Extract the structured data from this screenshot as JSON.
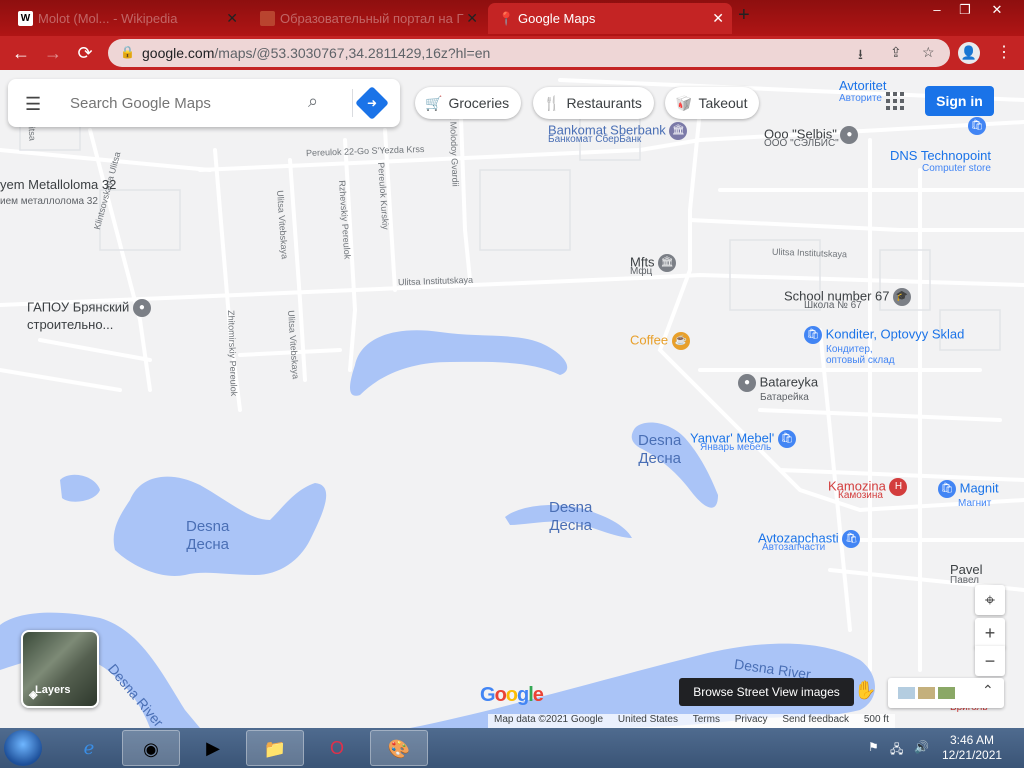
{
  "browser": {
    "tabs": [
      {
        "title": "Molot (Mol... - Wikipedia",
        "favicon": "W",
        "state": "inactive"
      },
      {
        "title": "Образовательный портал на Г",
        "favicon": "logo",
        "state": "inactive"
      },
      {
        "title": "Google Maps",
        "favicon": "maps-pin",
        "state": "active"
      }
    ],
    "new_tab": "+",
    "window_controls": {
      "minimize": "–",
      "restore": "❐",
      "close": "✕"
    },
    "nav": {
      "back": "←",
      "forward": "→",
      "reload": "⟳"
    },
    "url_host": "google.com",
    "url_path": "/maps/@53.3030767,34.2811429,16z?hl=en"
  },
  "maps": {
    "search_placeholder": "Search Google Maps",
    "chips": [
      {
        "label": "Groceries",
        "icon": "🛒"
      },
      {
        "label": "Restaurants",
        "icon": "🍴"
      },
      {
        "label": "Takeout",
        "icon": "🥡"
      }
    ],
    "signin": "Sign in",
    "layers_label": "Layers",
    "tooltip": "Browse Street View images",
    "logo": "Google",
    "footer": {
      "map_data": "Map data ©2021 Google",
      "country": "United States",
      "terms": "Terms",
      "privacy": "Privacy",
      "feedback": "Send feedback",
      "scale": "500 ft"
    },
    "controls": {
      "locate": "⌖",
      "zoom_in": "+",
      "zoom_out": "−",
      "expand": "⌃"
    },
    "streets": {
      "s1": "Pereulok 22-Go S'Yezda Krss",
      "s2": "Ulitsa Institutskaya",
      "s3": "Ulitsa Institutskaya",
      "s4": "Klintsovskaya Ulitsa",
      "s5": "Ulitsa Vitebskaya",
      "s6": "Rzhevskiy Pereulok",
      "s7": "Pereulok Kurskiy",
      "s8": "a Molodoy Gvardii",
      "s9": "Zhitomirskiy Pereulok",
      "s10": "Ulitsa Vitebskaya",
      "s11": "Ulitsa"
    },
    "places": {
      "metalloloma": "yem Metalloloma 32",
      "metalloloma_ru": "ием металлолома 32",
      "gapou": "ГАПОУ Брянский",
      "gapou2": "строительно...",
      "sberbank": "Bankomat Sberbank",
      "sberbank_ru": "Банкомат СберБанк",
      "selbis": "Ooo \"Selbis\"",
      "selbis_ru": "ООО \"СЭЛБИС\"",
      "avtoritet": "Avtoritet",
      "avtoritet_ru": "Авторите",
      "dns": "DNS Technopoint",
      "dns_sub": "Computer store",
      "mfts": "Mfts",
      "mfts_ru": "Мфц",
      "school": "School number 67",
      "school_ru": "Школа № 67",
      "coffee": "Coffee",
      "konditer": "Konditer, Optovyy Sklad",
      "konditer_ru1": "Кондитер,",
      "konditer_ru2": "оптовый склад",
      "batareyka": "Batareyka",
      "batareyka_ru": "Батарейка",
      "yanvar": "Yanvar' Mebel'",
      "yanvar_ru": "Январь мебель",
      "kamozina": "Kamozina",
      "kamozina_ru": "Камозина",
      "magnit": "Magnit",
      "magnit_ru": "Магнит",
      "avtozap": "Avtozapchasti",
      "avtozap_ru": "Автозапчасти",
      "pavel": "Pavel",
      "pavel_ru": "Павел",
      "brigol": "Бриголь"
    },
    "water": {
      "desna1": "Desna",
      "desna1_ru": "Десна",
      "desna2": "Desna",
      "desna2_ru": "Десна",
      "desna3": "Desna",
      "desna3_ru": "Десна",
      "river1": "Desna River",
      "river2": "Desna River"
    }
  },
  "taskbar": {
    "time": "3:46 AM",
    "date": "12/21/2021"
  },
  "colors": {
    "water": "#aac4f7",
    "water_deep": "#8fb0f4",
    "road": "#ffffff",
    "chrome_red": "#c42424",
    "accent": "#1a73e8",
    "poi_blue": "#4285f4",
    "poi_gray": "#7b7f86",
    "poi_orange": "#e8a02b",
    "poi_red": "#d33d3d"
  }
}
